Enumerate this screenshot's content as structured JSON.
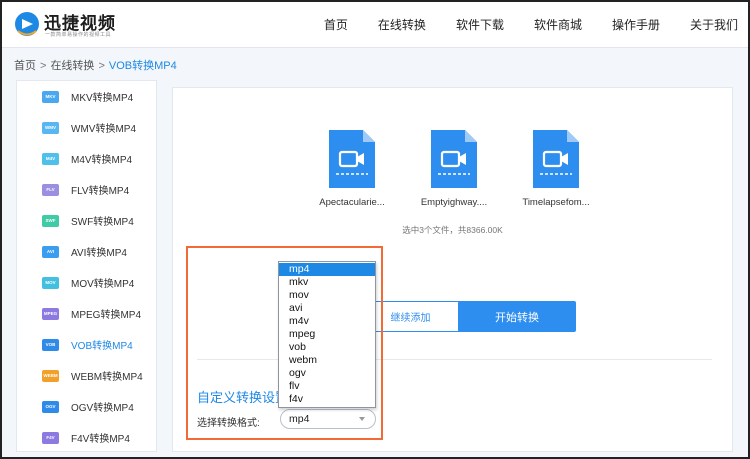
{
  "brand": {
    "name": "迅捷视频",
    "slogan": "一款简单易操作的视频工具",
    "color": "#1e88e5"
  },
  "nav": [
    "首页",
    "在线转换",
    "软件下载",
    "软件商城",
    "操作手册",
    "关于我们"
  ],
  "breadcrumb": {
    "home": "首页",
    "section": "在线转换",
    "current": "VOB转换MP4",
    "separator": ">"
  },
  "sidebar": {
    "items": [
      {
        "badge": "MKV",
        "label": "MKV转换MP4",
        "color": "#4aa8f0"
      },
      {
        "badge": "WMV",
        "label": "WMV转换MP4",
        "color": "#58b6f2"
      },
      {
        "badge": "M4V",
        "label": "M4V转换MP4",
        "color": "#4fc0ea"
      },
      {
        "badge": "FLV",
        "label": "FLV转换MP4",
        "color": "#9a8fe0"
      },
      {
        "badge": "SWF",
        "label": "SWF转换MP4",
        "color": "#3fcba5"
      },
      {
        "badge": "AVI",
        "label": "AVI转换MP4",
        "color": "#3a9ef0"
      },
      {
        "badge": "MOV",
        "label": "MOV转换MP4",
        "color": "#43bfe0"
      },
      {
        "badge": "MPEG",
        "label": "MPEG转换MP4",
        "color": "#8c7ae0"
      },
      {
        "badge": "VOB",
        "label": "VOB转换MP4",
        "color": "#2f8bea",
        "active": true
      },
      {
        "badge": "WEBM",
        "label": "WEBM转换MP4",
        "color": "#f3a02b"
      },
      {
        "badge": "OGV",
        "label": "OGV转换MP4",
        "color": "#2f8bea"
      },
      {
        "badge": "F4V",
        "label": "F4V转换MP4",
        "color": "#8c7ae0"
      }
    ]
  },
  "files": [
    {
      "name": "Apectacularie...",
      "icon": "video-file-icon"
    },
    {
      "name": "Emptyighway....",
      "icon": "video-file-icon"
    },
    {
      "name": "Timelapsefom...",
      "icon": "video-file-icon"
    }
  ],
  "file_summary": "选中3个文件，共8366.00K",
  "buttons": {
    "continue_add": "继续添加",
    "start_convert": "开始转换"
  },
  "settings": {
    "title": "自定义转换设置",
    "format_label": "选择转换格式:",
    "selected_format": "mp4",
    "options": [
      "mp4",
      "mkv",
      "mov",
      "avi",
      "m4v",
      "mpeg",
      "vob",
      "webm",
      "ogv",
      "flv",
      "f4v"
    ]
  },
  "colors": {
    "accent": "#2e8ef0",
    "highlight": "#f26a36",
    "file_icon": "#2e8ef0"
  }
}
